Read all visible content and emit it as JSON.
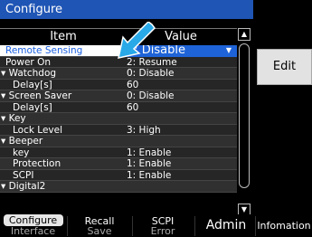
{
  "title": "Configure",
  "header": {
    "item": "Item",
    "value": "Value"
  },
  "rows": [
    {
      "item": "Remote Sensing",
      "value": "0: Disable",
      "style": "selected"
    },
    {
      "item": "Power On",
      "value": "2: Resume",
      "style": ""
    },
    {
      "item": "▾ Watchdog",
      "value": "0: Disable",
      "style": "group"
    },
    {
      "item": "Delay[s]",
      "value": "60",
      "style": "indent"
    },
    {
      "item": "▾ Screen Saver",
      "value": "0: Disable",
      "style": "group"
    },
    {
      "item": "Delay[s]",
      "value": "60",
      "style": "indent"
    },
    {
      "item": "▾ Key",
      "value": "",
      "style": "group"
    },
    {
      "item": "Lock Level",
      "value": "3: High",
      "style": "indent"
    },
    {
      "item": "▾ Beeper",
      "value": "",
      "style": "group"
    },
    {
      "item": "key",
      "value": "1: Enable",
      "style": "indent"
    },
    {
      "item": "Protection",
      "value": "1: Enable",
      "style": "indent"
    },
    {
      "item": "SCPI",
      "value": "1: Enable",
      "style": "indent"
    },
    {
      "item": "▾ Digital2",
      "value": "",
      "style": "group"
    }
  ],
  "edit_label": "Edit",
  "softkeys": {
    "configure": {
      "l1": "Configure",
      "l2": "Interface"
    },
    "recall": {
      "l1": "Recall",
      "l2": "Save"
    },
    "scpi": {
      "l1": "SCPI",
      "l2": "Error"
    },
    "admin": "Admin",
    "info": "Infomation"
  },
  "icons": {
    "dropdown": "triangle-down",
    "scroll_up": "triangle-up",
    "scroll_down": "triangle-down",
    "pointer": "arrow-pointer"
  },
  "colors": {
    "title_bar": "#1f55b5",
    "selected_value_bg": "#1e63d8",
    "arrow": "#29a9e8"
  }
}
